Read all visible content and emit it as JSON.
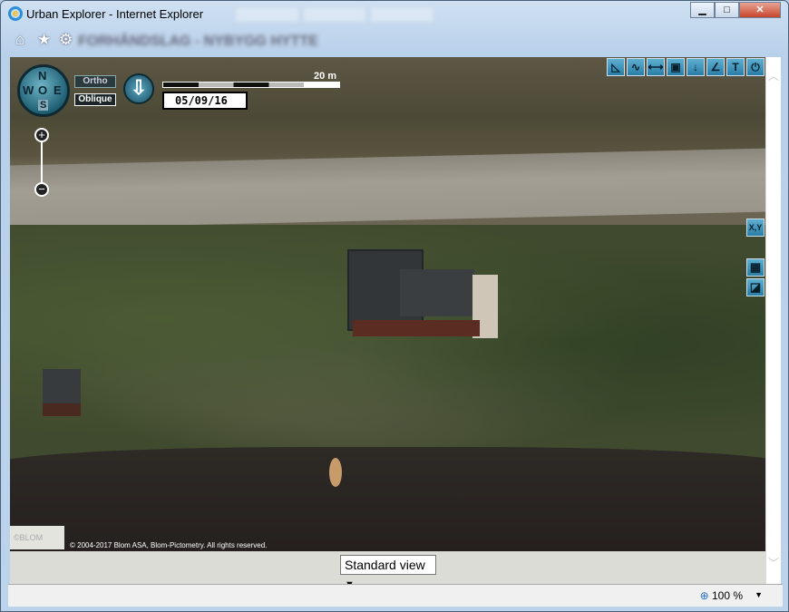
{
  "window": {
    "title": "Urban Explorer - Internet Explorer",
    "minimize": "▁",
    "maximize": "□",
    "close": "✕"
  },
  "toolbar": {
    "home": "⌂",
    "favorites": "★",
    "settings": "⚙",
    "page_title_blurred": "FORHÅNDSLAG - NYBYGG HYTTE"
  },
  "map": {
    "compass": {
      "n": "N",
      "w": "W",
      "o": "O",
      "e": "E",
      "s": "S"
    },
    "ortho": "Ortho",
    "oblique": "Oblique",
    "download": "⇩",
    "scale_label": "20 m",
    "date": "05/09/16",
    "zoom_in": "+",
    "zoom_out": "−",
    "tools": [
      "◺",
      "∿",
      "⟷",
      "▣",
      "↓",
      "∠",
      "T",
      "⏻"
    ],
    "xy": "X,Y",
    "grid": "▦",
    "layers": "◪",
    "logo": "©BLOM",
    "copyright": "© 2004-2017 Blom ASA, Blom-Pictometry. All rights reserved."
  },
  "view_select": {
    "value": "Standard view"
  },
  "status": {
    "zoom": "100 %"
  },
  "colors": {
    "tool_accent": "#2a7ea6",
    "frame": "#b9d1ea"
  }
}
